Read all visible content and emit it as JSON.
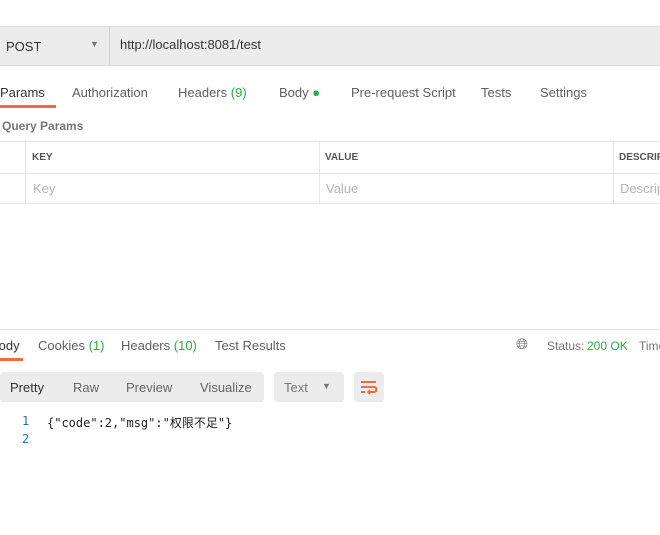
{
  "request": {
    "method": "POST",
    "url": "http://localhost:8081/test"
  },
  "request_tabs": [
    {
      "label": "Params"
    },
    {
      "label": "Authorization"
    },
    {
      "label": "Headers",
      "count": "(9)"
    },
    {
      "label": "Body"
    },
    {
      "label": "Pre-request Script"
    },
    {
      "label": "Tests"
    },
    {
      "label": "Settings"
    }
  ],
  "query_params": {
    "title": "Query Params",
    "columns": [
      "KEY",
      "VALUE",
      "DESCRIPTION"
    ],
    "placeholders": [
      "Key",
      "Value",
      "Description"
    ]
  },
  "response_tabs": [
    {
      "label": "Body"
    },
    {
      "label": "Cookies",
      "count": "(1)"
    },
    {
      "label": "Headers",
      "count": "(10)"
    },
    {
      "label": "Test Results"
    }
  ],
  "status": {
    "label": "Status:",
    "value": "200 OK",
    "time_label": "Time"
  },
  "view_modes": [
    "Pretty",
    "Raw",
    "Preview",
    "Visualize"
  ],
  "format": "Text",
  "code_lines": [
    {
      "n": "1",
      "text": "{\"code\":2,\"msg\":\"权限不足\"}"
    },
    {
      "n": "2",
      "text": ""
    }
  ],
  "colors": {
    "accent": "#f26b3a",
    "success": "#26b047"
  }
}
